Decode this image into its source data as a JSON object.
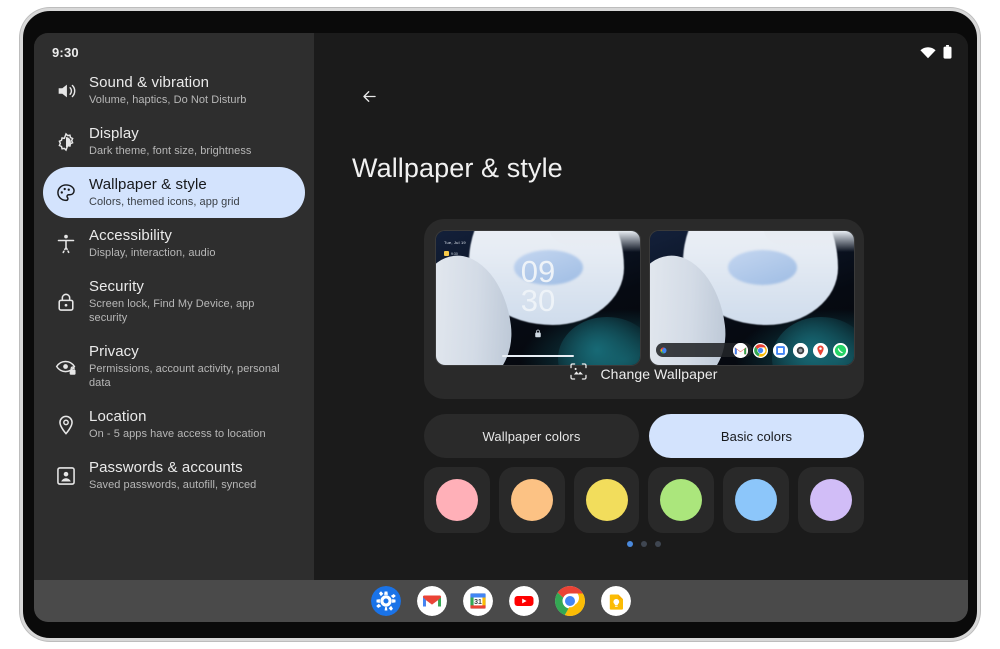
{
  "status_bar": {
    "time": "9:30",
    "wifi_icon": "wifi-icon",
    "battery_icon": "battery-icon"
  },
  "sidebar": {
    "items": [
      {
        "icon": "volume-icon",
        "title": "Sound & vibration",
        "subtitle": "Volume, haptics, Do Not Disturb",
        "selected": false
      },
      {
        "icon": "brightness-icon",
        "title": "Display",
        "subtitle": "Dark theme, font size, brightness",
        "selected": false
      },
      {
        "icon": "palette-icon",
        "title": "Wallpaper & style",
        "subtitle": "Colors, themed icons, app grid",
        "selected": true
      },
      {
        "icon": "accessibility-icon",
        "title": "Accessibility",
        "subtitle": "Display, interaction, audio",
        "selected": false
      },
      {
        "icon": "lock-icon",
        "title": "Security",
        "subtitle": "Screen lock, Find My Device, app security",
        "selected": false
      },
      {
        "icon": "eye-lock-icon",
        "title": "Privacy",
        "subtitle": "Permissions, account activity, personal data",
        "selected": false
      },
      {
        "icon": "location-pin-icon",
        "title": "Location",
        "subtitle": "On - 5 apps have access to location",
        "selected": false
      },
      {
        "icon": "account-box-icon",
        "title": "Passwords & accounts",
        "subtitle": "Saved passwords, autofill, synced",
        "selected": false
      }
    ]
  },
  "main": {
    "back_icon": "back-arrow-icon",
    "title": "Wallpaper & style",
    "wallpaper_card": {
      "lock_preview": {
        "name": "lock-screen-preview",
        "date_text": "Tue, Jul 19",
        "notification_text": "9:30",
        "clock_hours": "09",
        "clock_minutes": "30",
        "lock_icon": "lock-icon"
      },
      "home_preview": {
        "name": "home-screen-preview",
        "search_placeholder": "",
        "dock_icons": [
          "gmail-icon",
          "chrome-icon",
          "photos-icon",
          "camera-icon",
          "maps-icon",
          "whatsapp-icon"
        ]
      },
      "change_wallpaper": {
        "icon": "image-icon",
        "label": "Change Wallpaper"
      }
    },
    "color_tabs": [
      {
        "label": "Wallpaper colors",
        "active": false
      },
      {
        "label": "Basic colors",
        "active": true
      }
    ],
    "swatches": [
      {
        "name": "swatch-pink",
        "color": "#FFB0B8"
      },
      {
        "name": "swatch-orange",
        "color": "#FCC284"
      },
      {
        "name": "swatch-yellow",
        "color": "#F2DD5C"
      },
      {
        "name": "swatch-green",
        "color": "#ABE67C"
      },
      {
        "name": "swatch-blue",
        "color": "#8CC6FA"
      },
      {
        "name": "swatch-purple",
        "color": "#D1BDF7"
      }
    ],
    "page_dots": {
      "count": 3,
      "active_index": 0,
      "active_color": "#4A89DC"
    }
  },
  "taskbar": {
    "icons": [
      {
        "name": "settings-icon",
        "label": "Settings"
      },
      {
        "name": "gmail-icon",
        "label": "Gmail"
      },
      {
        "name": "calendar-icon",
        "label": "Calendar",
        "day": "31"
      },
      {
        "name": "youtube-icon",
        "label": "YouTube"
      },
      {
        "name": "chrome-icon",
        "label": "Chrome"
      },
      {
        "name": "keep-icon",
        "label": "Keep"
      }
    ]
  },
  "theme": {
    "sidebar_bg": "#2E2E2E",
    "main_bg": "#1B1B1B",
    "card_bg": "#2A2A2A",
    "accent": "#D3E3FD",
    "taskbar_bg": "#4A4A4A"
  }
}
